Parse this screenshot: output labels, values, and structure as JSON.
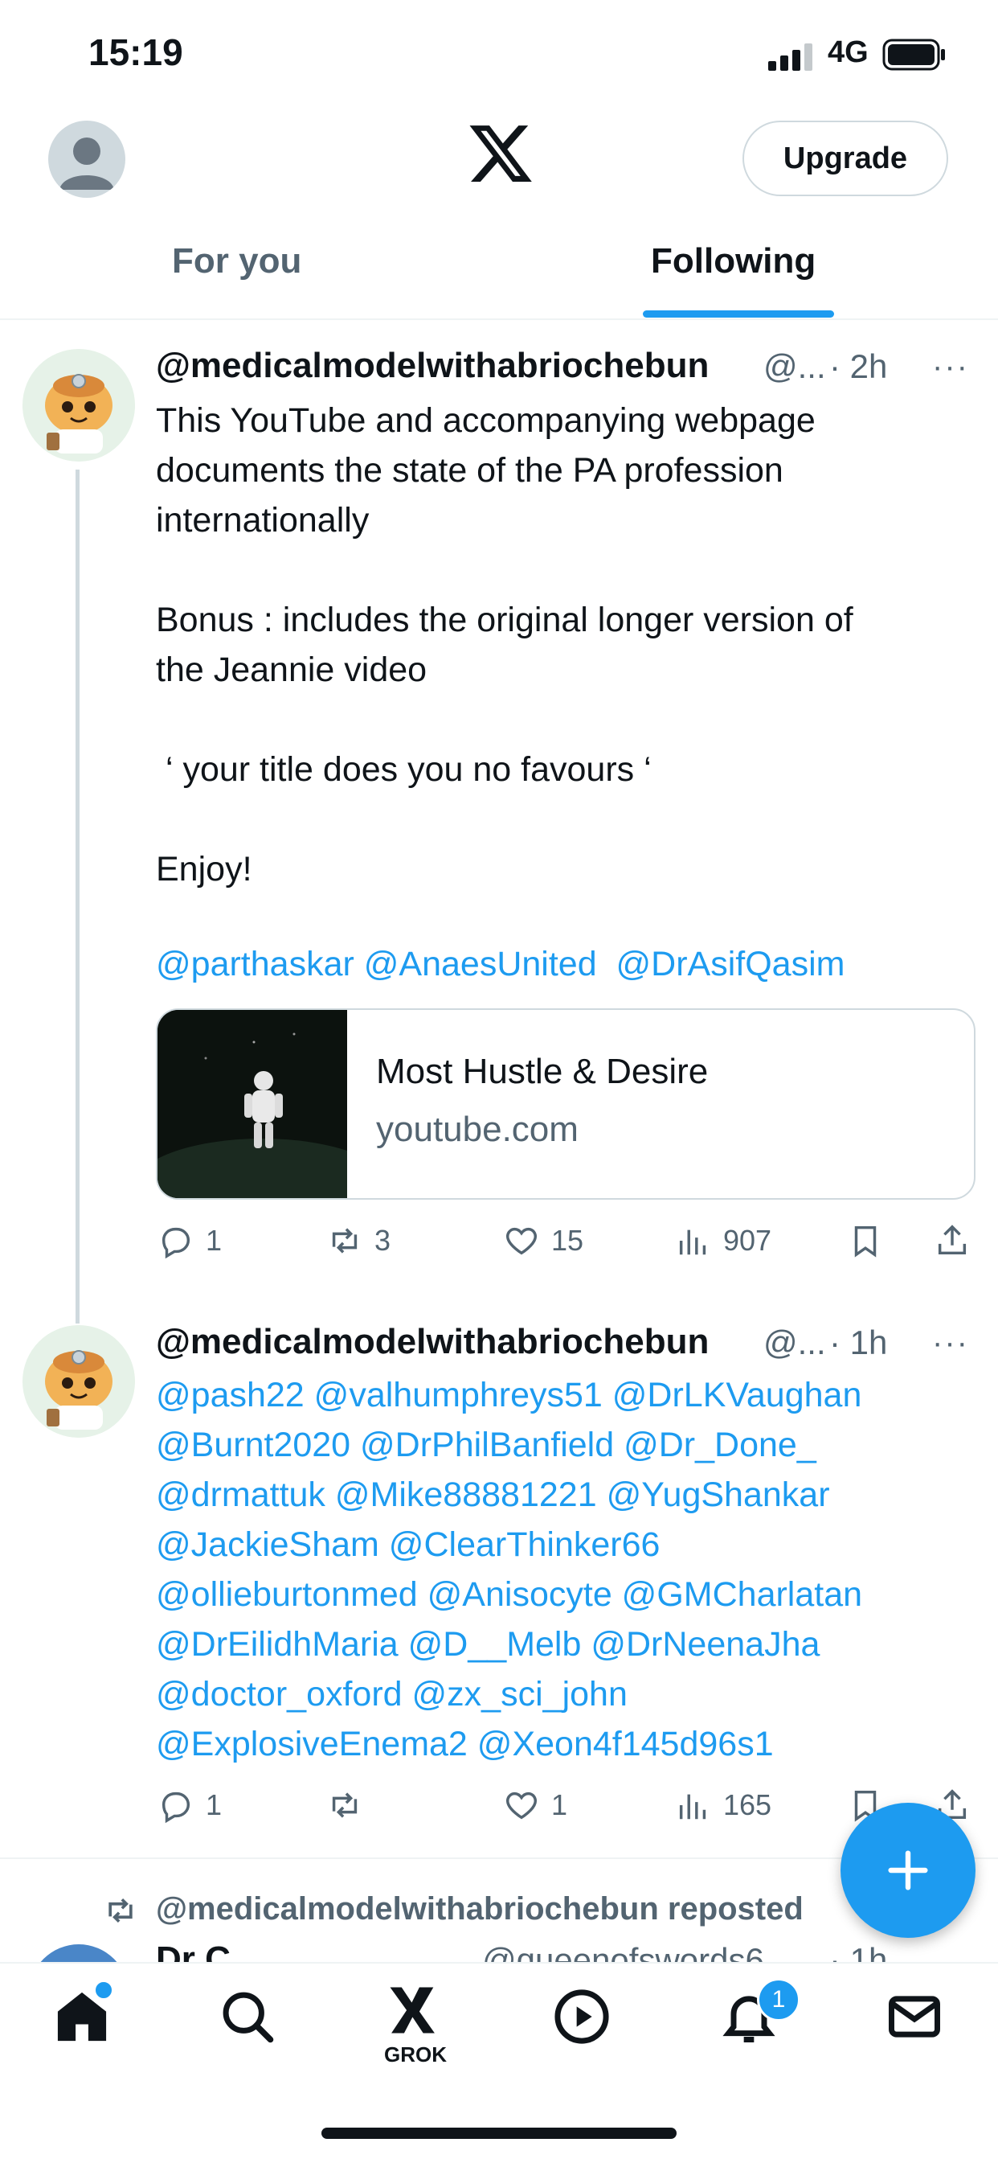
{
  "status_bar": {
    "time": "15:19",
    "network": "4G"
  },
  "header": {
    "upgrade_label": "Upgrade"
  },
  "tabs": [
    {
      "label": "For you"
    },
    {
      "label": "Following"
    }
  ],
  "tweets": [
    {
      "handle": "@medicalmodelwithabriochebun",
      "secondary": "@...",
      "time": "· 2h",
      "more": "···",
      "text": "This YouTube and accompanying webpage\ndocuments the state of the PA profession\ninternationally\n\nBonus : includes the original longer version of\nthe Jeannie video\n\n ‘ your title does you no favours ‘\n\nEnjoy!",
      "mentions": "@parthaskar @AnaesUnited  @DrAsifQasim",
      "card": {
        "title": "Most Hustle & Desire",
        "domain": "youtube.com"
      },
      "replies": "1",
      "reposts": "3",
      "likes": "15",
      "views": "907"
    },
    {
      "handle": "@medicalmodelwithabriochebun",
      "secondary": "@...",
      "time": "· 1h",
      "more": "···",
      "mentions_lines": [
        "@pash22 @valhumphreys51 @DrLKVaughan",
        "@Burnt2020 @DrPhilBanfield @Dr_Done_",
        "@drmattuk @Mike88881221 @YugShankar",
        "@JackieSham @ClearThinker66",
        "@ollieburtonmed @Anisocyte @GMCharlatan",
        "@DrEilidhMaria @D__Melb @DrNeenaJha",
        "@doctor_oxford @zx_sci_john",
        "@ExplosiveEnema2 @Xeon4f145d96s1"
      ],
      "replies": "1",
      "reposts": "",
      "likes": "1",
      "views": "165"
    }
  ],
  "repost_notice": "@medicalmodelwithabriochebun reposted",
  "next_tweet_partial": {
    "name": "Dr C",
    "handle": "@queenofswords6",
    "time": "· 1h"
  },
  "bottom_nav": {
    "grok_label": "GROK",
    "notifications_badge": "1"
  },
  "colors": {
    "accent": "#1d9bf0",
    "text": "#0f1419",
    "muted": "#536471",
    "border": "#cfd9de"
  },
  "icons": [
    "home-icon",
    "search-icon",
    "grok-icon",
    "play-icon",
    "bell-icon",
    "mail-icon",
    "reply-icon",
    "repost-icon",
    "like-icon",
    "views-icon",
    "bookmark-icon",
    "share-icon",
    "plus-icon",
    "x-logo-icon"
  ]
}
